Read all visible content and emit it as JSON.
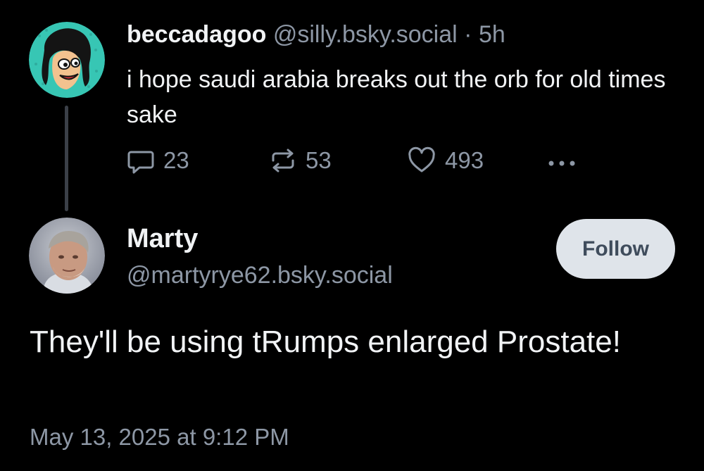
{
  "parent_post": {
    "author_name": "beccadagoo",
    "handle": "@silly.bsky.social",
    "separator": "·",
    "time_ago": "5h",
    "text": "i hope saudi arabia breaks out the orb for old times sake",
    "avatar_icon": "cartoon-woman-avatar",
    "actions": {
      "reply_count": "23",
      "repost_count": "53",
      "like_count": "493"
    }
  },
  "reply_post": {
    "author_name": "Marty",
    "handle": "@martyrye62.bsky.social",
    "avatar_icon": "photo-man-avatar",
    "follow_label": "Follow",
    "text": "They'll be using tRumps enlarged Prostate!",
    "timestamp": "May 13, 2025 at 9:12 PM"
  },
  "colors": {
    "background": "#000000",
    "primary_text": "#f1f3f5",
    "secondary_text": "#8d97a5",
    "follow_button_bg": "#dfe4ea",
    "avatar_teal": "#37c6b4"
  }
}
